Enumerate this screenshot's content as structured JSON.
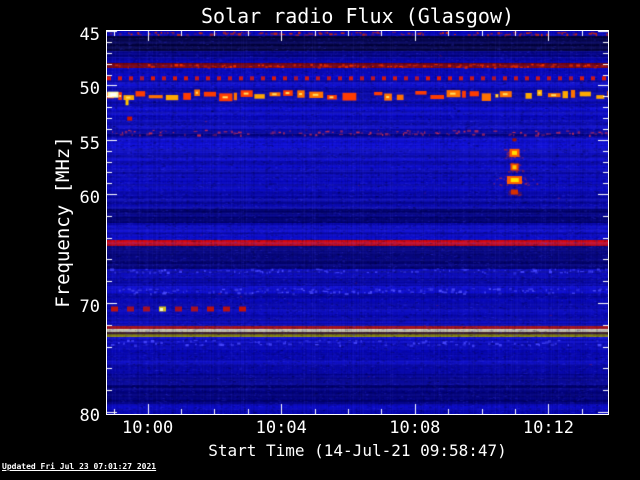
{
  "footer": {
    "updated": "Updated Fri Jul 23 07:01:27 2021"
  },
  "chart_data": {
    "type": "heatmap",
    "title": "Solar radio Flux (Glasgow)",
    "xlabel": "Start Time (14-Jul-21 09:58:47)",
    "ylabel": "Frequency [MHz]",
    "x_unit": "minutes since 09:58:47 UT",
    "x_range": [
      0,
      15
    ],
    "y_range": [
      45,
      80.2
    ],
    "x_ticks": [
      {
        "label": "10:00",
        "t": 1.2167
      },
      {
        "label": "10:04",
        "t": 5.2167
      },
      {
        "label": "10:08",
        "t": 9.2167
      },
      {
        "label": "10:12",
        "t": 13.2167
      }
    ],
    "x_minor_ticks": [
      0.2167,
      2.2167,
      3.2167,
      4.2167,
      6.2167,
      7.2167,
      8.2167,
      10.2167,
      11.2167,
      12.2167,
      14.2167
    ],
    "y_ticks": [
      {
        "label": "45",
        "f": 45
      },
      {
        "label": "50",
        "f": 50
      },
      {
        "label": "55",
        "f": 55
      },
      {
        "label": "60",
        "f": 60
      },
      {
        "label": "70",
        "f": 70
      },
      {
        "label": "80",
        "f": 80
      }
    ],
    "y_minor_ticks": [
      46,
      47,
      48,
      49,
      51,
      52,
      53,
      54,
      56,
      57,
      58,
      59,
      62,
      64,
      66,
      68,
      72,
      74,
      76,
      78
    ],
    "colormap": {
      "base_blue": "#0a0acc",
      "dark_navy": "#020230",
      "bright_red": "#ee0800",
      "orange": "#ff7200",
      "yellow": "#ffe060",
      "pale_yellow": "#ffffaa",
      "olive": "#aaa400",
      "tick_color": "#ffffff"
    },
    "background_bands": [
      {
        "f1": 45.0,
        "f2": 45.45,
        "color": "#0a0ad2",
        "name": "top-row"
      },
      {
        "f1": 45.45,
        "f2": 46.85,
        "color": "#020230",
        "name": "dark-band-46"
      },
      {
        "f1": 46.85,
        "f2": 47.35,
        "color": "#06068e"
      },
      {
        "f1": 47.35,
        "f2": 47.95,
        "color": "#0808b8"
      },
      {
        "f1": 47.95,
        "f2": 48.38,
        "color": "#8e0600",
        "name": "rfi-carrier-48MHz"
      },
      {
        "f1": 48.38,
        "f2": 49.0,
        "color": "#0a0ad0"
      },
      {
        "f1": 49.0,
        "f2": 49.7,
        "color": "#0909c8"
      },
      {
        "f1": 49.7,
        "f2": 50.4,
        "color": "#0b0bd2"
      },
      {
        "f1": 50.4,
        "f2": 51.35,
        "color": "#0909c2",
        "name": "blob-row-bg"
      },
      {
        "f1": 51.35,
        "f2": 52.4,
        "color": "#0d0dd8"
      },
      {
        "f1": 52.4,
        "f2": 53.9,
        "color": "#0b0bd0"
      },
      {
        "f1": 53.9,
        "f2": 54.75,
        "color": "#0a0ac2",
        "name": "speckle-band-bg"
      },
      {
        "f1": 54.75,
        "f2": 56.6,
        "color": "#0f0fdc"
      },
      {
        "f1": 56.6,
        "f2": 58.6,
        "color": "#0c0cd4"
      },
      {
        "f1": 58.6,
        "f2": 60.2,
        "color": "#0a0ac8"
      },
      {
        "f1": 60.2,
        "f2": 61.4,
        "color": "#0808b0"
      },
      {
        "f1": 61.4,
        "f2": 62.65,
        "color": "#040480",
        "name": "dark-band-62"
      },
      {
        "f1": 62.65,
        "f2": 63.55,
        "color": "#0f0fdc"
      },
      {
        "f1": 63.55,
        "f2": 64.2,
        "color": "#0a0acc"
      },
      {
        "f1": 64.2,
        "f2": 64.78,
        "color": "#ee0800",
        "name": "rfi-carrier-64.5MHz"
      },
      {
        "f1": 64.78,
        "f2": 66.9,
        "color": "#040478",
        "name": "dark-band-66"
      },
      {
        "f1": 66.9,
        "f2": 67.7,
        "color": "#0a0ac6"
      },
      {
        "f1": 67.7,
        "f2": 68.4,
        "color": "#0808b6"
      },
      {
        "f1": 68.4,
        "f2": 69.4,
        "color": "#0f0fda",
        "name": "light-band-69"
      },
      {
        "f1": 69.4,
        "f2": 72.08,
        "color": "#0a0aca"
      },
      {
        "f1": 72.08,
        "f2": 72.35,
        "color": "#da1600",
        "name": "cal-line-red"
      },
      {
        "f1": 72.35,
        "f2": 72.65,
        "color": "#ffffaa",
        "name": "cal-line-bright-yellow"
      },
      {
        "f1": 72.65,
        "f2": 72.85,
        "color": "#58280a",
        "name": "cal-gap"
      },
      {
        "f1": 72.85,
        "f2": 73.15,
        "color": "#aaa400",
        "name": "cal-line-olive"
      },
      {
        "f1": 73.15,
        "f2": 74.3,
        "color": "#0e0ed8"
      },
      {
        "f1": 74.3,
        "f2": 76.5,
        "color": "#0909c2"
      },
      {
        "f1": 76.5,
        "f2": 77.7,
        "color": "#0707a2"
      },
      {
        "f1": 77.7,
        "f2": 79.3,
        "color": "#05058a",
        "name": "dark-band-78"
      },
      {
        "f1": 79.3,
        "f2": 80.2,
        "color": "#0909c8"
      }
    ],
    "features": [
      {
        "name": "edge-interference-45MHz",
        "type": "speckle_row",
        "f": 45.18,
        "h": 3,
        "color": "#d22800",
        "density": 0.5
      },
      {
        "name": "rfi-speckles-48.1MHz",
        "type": "speckle_row",
        "f": 48.15,
        "h": 3,
        "color": "#f03000",
        "density": 0.45
      },
      {
        "name": "rfi-dashes-49.3MHz",
        "type": "dash_row",
        "f": 49.35,
        "t1": 0,
        "t2": 15,
        "dash": 4,
        "gap": 7,
        "thickness": 4,
        "color": "#e81c00"
      },
      {
        "name": "rfi-burst-row-50.9MHz",
        "type": "blob_row",
        "f": 50.9,
        "colors": [
          "#ff3c00",
          "#ff7200",
          "#ffaa00",
          "#ffe060"
        ],
        "density": 0.72
      },
      {
        "name": "bright-blob-start-50.9MHz",
        "type": "blob",
        "t": 0.18,
        "f": 50.85,
        "w": 11,
        "hMHz": 0.55,
        "color": "#ffffb6",
        "core": "#ffffff"
      },
      {
        "name": "yellow-streak-51.5MHz",
        "type": "blob",
        "t": 0.6,
        "f": 51.55,
        "w": 3,
        "hMHz": 0.55,
        "color": "#ffc400"
      },
      {
        "name": "red-dot-53MHz",
        "type": "blob",
        "t": 0.68,
        "f": 53.05,
        "w": 5,
        "hMHz": 0.4,
        "color": "#cc1600"
      },
      {
        "name": "rfi-speckle-band-54.3MHz",
        "type": "speckle_row",
        "f": 54.3,
        "h": 5,
        "color": "#c22c55",
        "density": 0.5
      },
      {
        "name": "speckle-row-67MHz",
        "type": "speckle_row",
        "f": 67.0,
        "h": 4,
        "color": "#4646ff",
        "density": 0.4
      },
      {
        "name": "speckle-row-68.8MHz",
        "type": "speckle_row",
        "f": 68.85,
        "h": 5,
        "color": "#5050ff",
        "density": 0.45
      },
      {
        "name": "speckle-row-73.6MHz",
        "type": "speckle_row",
        "f": 73.6,
        "h": 5,
        "color": "#4848ff",
        "density": 0.4
      },
      {
        "name": "rfi-dashes-70.5MHz",
        "type": "dash_row",
        "f": 70.55,
        "t1": 0.12,
        "t2": 4.4,
        "dash": 7,
        "gap": 9,
        "thickness": 5,
        "color": "#cc1200",
        "highlight_t": 1.32,
        "highlight_color": "#ffe800"
      },
      {
        "name": "burst-dot-55MHz",
        "type": "blob",
        "t": 12.2,
        "f": 55.0,
        "w": 4,
        "hMHz": 0.3,
        "color": "#a01200"
      },
      {
        "name": "burst-blob-56.2MHz",
        "type": "blob",
        "t": 12.2,
        "f": 56.2,
        "w": 10,
        "hMHz": 0.75,
        "color": "#ff5a00",
        "core": "#ffde00",
        "halo": "#b02840",
        "haloW": 22
      },
      {
        "name": "burst-blob-57.5MHz",
        "type": "blob",
        "t": 12.2,
        "f": 57.5,
        "w": 8,
        "hMHz": 0.6,
        "color": "#f04600",
        "core": "#ffc400",
        "halo": "#a02438",
        "haloW": 16
      },
      {
        "name": "burst-band-58.7MHz",
        "type": "blob",
        "t": 12.2,
        "f": 58.7,
        "w": 15,
        "hMHz": 0.7,
        "color": "#ff6000",
        "core": "#ffe400",
        "halo": "#b02850",
        "haloW": 46
      },
      {
        "name": "burst-dot-59.8MHz",
        "type": "blob",
        "t": 12.2,
        "f": 59.8,
        "w": 7,
        "hMHz": 0.5,
        "color": "#d73000",
        "halo": "#8c1e30",
        "haloW": 12
      }
    ]
  }
}
